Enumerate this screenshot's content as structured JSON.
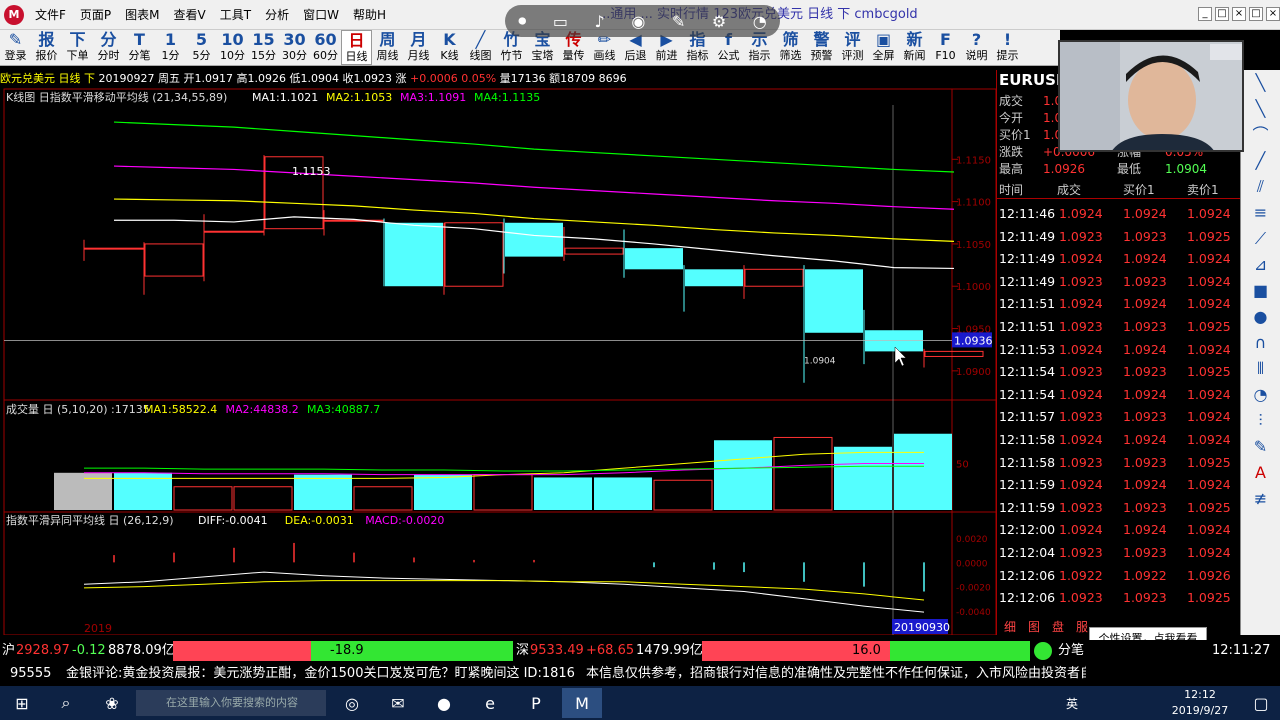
{
  "app": {
    "menus": [
      "文件F",
      "页面P",
      "图表M",
      "查看V",
      "工具T",
      "分析",
      "窗口W",
      "帮助H"
    ],
    "title": "...通用 ... 实时行情 123欧元兑美元 日线 下 cmbcgold",
    "win_controls": [
      "_",
      "□",
      "×",
      "□",
      "×"
    ]
  },
  "toolbar": {
    "items": [
      {
        "icon": "✎",
        "label": "登录"
      },
      {
        "icon": "报",
        "label": "报价"
      },
      {
        "icon": "下",
        "label": "下单"
      },
      {
        "icon": "分",
        "label": "分时"
      },
      {
        "icon": "T",
        "label": "分笔"
      },
      {
        "icon": "1",
        "label": "1分"
      },
      {
        "icon": "5",
        "label": "5分"
      },
      {
        "icon": "10",
        "label": "10分"
      },
      {
        "icon": "15",
        "label": "15分"
      },
      {
        "icon": "30",
        "label": "30分"
      },
      {
        "icon": "60",
        "label": "60分"
      },
      {
        "icon": "日",
        "label": "日线"
      },
      {
        "icon": "周",
        "label": "周线"
      },
      {
        "icon": "月",
        "label": "月线"
      },
      {
        "icon": "K",
        "label": "K线"
      },
      {
        "icon": "╱",
        "label": "线图"
      },
      {
        "icon": "竹",
        "label": "竹节"
      },
      {
        "icon": "宝",
        "label": "宝塔"
      },
      {
        "icon": "传",
        "label": "量传"
      },
      {
        "icon": "✏",
        "label": "画线"
      },
      {
        "icon": "◀",
        "label": "后退"
      },
      {
        "icon": "▶",
        "label": "前进"
      },
      {
        "icon": "指",
        "label": "指标"
      },
      {
        "icon": "f",
        "label": "公式"
      },
      {
        "icon": "示",
        "label": "指示"
      },
      {
        "icon": "筛",
        "label": "筛选"
      },
      {
        "icon": "警",
        "label": "预警"
      },
      {
        "icon": "评",
        "label": "评测"
      },
      {
        "icon": "▣",
        "label": "全屏"
      },
      {
        "icon": "新",
        "label": "新闻"
      },
      {
        "icon": "F",
        "label": "F10"
      },
      {
        "icon": "?",
        "label": "说明"
      },
      {
        "icon": "!",
        "label": "提示"
      }
    ],
    "active_index": 11
  },
  "status_bar": {
    "name": "欧元兑美元",
    "period": "日线 下",
    "date": "20190927",
    "weekday": "周五",
    "open": "开1.0917",
    "high": "高1.0926",
    "low": "低1.0904",
    "close": "收1.0923",
    "change_label": "涨",
    "change": "+0.0006",
    "change_pct": "0.05%",
    "volume": "量17136",
    "amount": "额18709",
    "amount2": "8696"
  },
  "chart_data": [
    {
      "type": "candlestick",
      "title": "K线图 日指数平滑移动平均线 (21,34,55,89)",
      "ma_labels": [
        {
          "text": "MA1:1.1021",
          "color": "#ffffff"
        },
        {
          "text": "MA2:1.1053",
          "color": "#ffff00"
        },
        {
          "text": "MA3:1.1091",
          "color": "#ff00ff"
        },
        {
          "text": "MA4:1.1135",
          "color": "#00ff00"
        }
      ],
      "ylim": [
        1.0875,
        1.12
      ],
      "y_ticks": [
        "1.1150",
        "1.1100",
        "1.1050",
        "1.1000",
        "1.0950",
        "1.0900"
      ],
      "crosshair_value": "1.0936",
      "max_label": "1.1153",
      "min_label": "1.0904",
      "candles": [
        {
          "o": 1.1045,
          "h": 1.1055,
          "l": 1.103,
          "c": 1.1045
        },
        {
          "o": 1.1012,
          "h": 1.1052,
          "l": 1.099,
          "c": 1.105
        },
        {
          "o": 1.1065,
          "h": 1.1085,
          "l": 0.0,
          "c": 1.1065
        },
        {
          "o": 1.1068,
          "h": 1.1155,
          "l": 1.106,
          "c": 1.1153
        },
        {
          "o": 1.1078,
          "h": 1.109,
          "l": 1.106,
          "c": 1.1078
        },
        {
          "o": 1.1075,
          "h": 1.108,
          "l": 1.1,
          "c": 1.1
        },
        {
          "o": 1.1,
          "h": 1.1075,
          "l": 1.099,
          "c": 1.1075
        },
        {
          "o": 1.1075,
          "h": 1.108,
          "l": 1.1015,
          "c": 1.1035
        },
        {
          "o": 1.1038,
          "h": 1.107,
          "l": 1.103,
          "c": 1.1045
        },
        {
          "o": 1.1045,
          "h": 1.1067,
          "l": 1.101,
          "c": 1.102
        },
        {
          "o": 1.102,
          "h": 1.1025,
          "l": 1.097,
          "c": 1.1
        },
        {
          "o": 1.1,
          "h": 1.1025,
          "l": 1.0985,
          "c": 1.102
        },
        {
          "o": 1.102,
          "h": 1.1025,
          "l": 0.0,
          "c": 1.0945
        },
        {
          "o": 1.0948,
          "h": 1.0972,
          "l": 1.0908,
          "c": 1.0923
        },
        {
          "o": 1.0917,
          "h": 1.0926,
          "l": 1.0904,
          "c": 1.0923
        }
      ],
      "ma_series": [
        {
          "name": "MA1",
          "color": "#ffffff",
          "values": [
            1.1078,
            1.1078,
            1.1076,
            1.1082,
            1.1079,
            1.1072,
            1.1068,
            1.106,
            1.1056,
            1.105,
            1.1043,
            1.1036,
            1.103,
            1.1022,
            1.1021
          ]
        },
        {
          "name": "MA2",
          "color": "#ffff00",
          "values": [
            1.1103,
            1.1102,
            1.1101,
            1.1098,
            1.1095,
            1.109,
            1.1086,
            1.108,
            1.1076,
            1.1072,
            1.1067,
            1.1063,
            1.106,
            1.1056,
            1.1053
          ]
        },
        {
          "name": "MA3",
          "color": "#ff00ff",
          "values": [
            1.1142,
            1.114,
            1.1138,
            1.1134,
            1.113,
            1.1126,
            1.1122,
            1.1117,
            1.1113,
            1.1109,
            1.1105,
            1.1101,
            1.1098,
            1.1094,
            1.1091
          ]
        },
        {
          "name": "MA4",
          "color": "#00ff00",
          "values": [
            1.1194,
            1.1191,
            1.1188,
            1.1183,
            1.1178,
            1.1173,
            1.1168,
            1.1162,
            1.1158,
            1.1154,
            1.115,
            1.1146,
            1.1142,
            1.1138,
            1.1135
          ]
        }
      ]
    },
    {
      "type": "bar",
      "title": "成交量 日 (5,10,20) :17135",
      "ma_labels": [
        {
          "text": "MA1:58522.4",
          "color": "#ffff00"
        },
        {
          "text": "MA2:44838.2",
          "color": "#ff00ff"
        },
        {
          "text": "MA3:40887.7",
          "color": "#00ff00"
        }
      ],
      "y_tick": "50",
      "ylim": [
        0,
        100
      ],
      "values": [
        40,
        40,
        25,
        25,
        38,
        25,
        38,
        38,
        35,
        35,
        32,
        75,
        78,
        68,
        82
      ],
      "up": [
        false,
        false,
        true,
        true,
        false,
        true,
        false,
        true,
        false,
        false,
        true,
        false,
        true,
        false,
        false
      ],
      "gray_first": true
    },
    {
      "type": "line",
      "title": "指数平滑异同平均线 日 (26,12,9)",
      "labels": [
        {
          "text": "DIFF:-0.0041",
          "color": "#ffffff"
        },
        {
          "text": "DEA:-0.0031",
          "color": "#ffff00"
        },
        {
          "text": "MACD:-0.0020",
          "color": "#ff00ff"
        }
      ],
      "y_ticks": [
        "0.0020",
        "0.0000",
        "-0.0020",
        "-0.0040"
      ],
      "ylim": [
        -0.0045,
        0.0025
      ]
    }
  ],
  "x_axis": {
    "left_label": "2019",
    "right_label": "20190930"
  },
  "right_panel": {
    "symbol": "EURUSD",
    "quote_rows": [
      {
        "k": "成交",
        "v": "1.0923",
        "k2": "",
        "v2": ""
      },
      {
        "k": "今开",
        "v": "1.0917",
        "k2": "",
        "v2": ""
      },
      {
        "k": "买价1",
        "v": "1.0923",
        "k2": "",
        "v2": ""
      },
      {
        "k": "涨跌",
        "v": "+0.0006",
        "k2": "涨幅",
        "v2": "0.05%"
      },
      {
        "k": "最高",
        "v": "1.0926",
        "k2": "最低",
        "v2": "1.0904"
      }
    ],
    "ticks_header": [
      "时间",
      "成交",
      "买价1",
      "卖价1"
    ],
    "ticks": [
      {
        "t": "12:11:46",
        "p": "1.0924",
        "b": "1.0924",
        "a": "1.0924",
        "dir": "up"
      },
      {
        "t": "12:11:49",
        "p": "1.0923",
        "b": "1.0923",
        "a": "1.0925",
        "dir": "down"
      },
      {
        "t": "12:11:49",
        "p": "1.0924",
        "b": "1.0924",
        "a": "1.0924",
        "dir": "up"
      },
      {
        "t": "12:11:49",
        "p": "1.0923",
        "b": "1.0923",
        "a": "1.0924",
        "dir": "down"
      },
      {
        "t": "12:11:51",
        "p": "1.0924",
        "b": "1.0924",
        "a": "1.0924",
        "dir": "up"
      },
      {
        "t": "12:11:51",
        "p": "1.0923",
        "b": "1.0923",
        "a": "1.0925",
        "dir": "down"
      },
      {
        "t": "12:11:53",
        "p": "1.0924",
        "b": "1.0924",
        "a": "1.0924",
        "dir": "up"
      },
      {
        "t": "12:11:54",
        "p": "1.0923",
        "b": "1.0923",
        "a": "1.0925",
        "dir": "down"
      },
      {
        "t": "12:11:54",
        "p": "1.0924",
        "b": "1.0924",
        "a": "1.0924",
        "dir": "up"
      },
      {
        "t": "12:11:57",
        "p": "1.0923",
        "b": "1.0923",
        "a": "1.0924",
        "dir": "down"
      },
      {
        "t": "12:11:58",
        "p": "1.0924",
        "b": "1.0924",
        "a": "1.0924",
        "dir": "up"
      },
      {
        "t": "12:11:58",
        "p": "1.0923",
        "b": "1.0923",
        "a": "1.0925",
        "dir": "down"
      },
      {
        "t": "12:11:59",
        "p": "1.0924",
        "b": "1.0924",
        "a": "1.0924",
        "dir": "up"
      },
      {
        "t": "12:11:59",
        "p": "1.0923",
        "b": "1.0923",
        "a": "1.0925",
        "dir": "down"
      },
      {
        "t": "12:12:00",
        "p": "1.0924",
        "b": "1.0924",
        "a": "1.0924",
        "dir": "up"
      },
      {
        "t": "12:12:04",
        "p": "1.0923",
        "b": "1.0923",
        "a": "1.0924",
        "dir": "down"
      },
      {
        "t": "12:12:06",
        "p": "1.0922",
        "b": "1.0922",
        "a": "1.0926",
        "dir": "down"
      },
      {
        "t": "12:12:06",
        "p": "1.0923",
        "b": "1.0923",
        "a": "1.0925",
        "dir": "down"
      }
    ],
    "tabs": [
      "细",
      "图",
      "盘",
      "服"
    ]
  },
  "tooltip": "个性设置，点我看看",
  "market_bar": {
    "sh_label": "沪",
    "sh_value": "2928.97",
    "sh_change": "-0.12",
    "sh_amount": "8878.09亿",
    "sh_bar_value": "-18.9",
    "sz_label": "深",
    "sz_value": "9533.49",
    "sz_change": "+68.65",
    "sz_amount": "1479.99亿",
    "sz_bar_value": "16.0",
    "fenbi": "分笔",
    "time": "12:11:27"
  },
  "ticker": {
    "code": "95555",
    "text": "金银评论:黄金投资晨报：美元涨势正酣，金价1500关口岌岌可危？盯紧晚间这 ID:1816",
    "disclaimer": "本信息仅供参考，招商银行对信息的准确性及完整性不作任何保证，入市风险由投资者自"
  },
  "taskbar": {
    "search_placeholder": "在这里输入你要搜索的内容",
    "time": "12:12",
    "date": "2019/9/27",
    "lang": "英"
  },
  "colors": {
    "up": "#ff3232",
    "down": "#54ffff",
    "axis": "#a00000",
    "ma1": "#ffffff",
    "ma2": "#ffff00",
    "ma3": "#ff00ff",
    "ma4": "#00ff00"
  },
  "capture_icons": [
    "stop-icon",
    "screen-icon",
    "mic-icon",
    "camera-icon",
    "brush-icon",
    "settings-icon",
    "timer-icon"
  ]
}
